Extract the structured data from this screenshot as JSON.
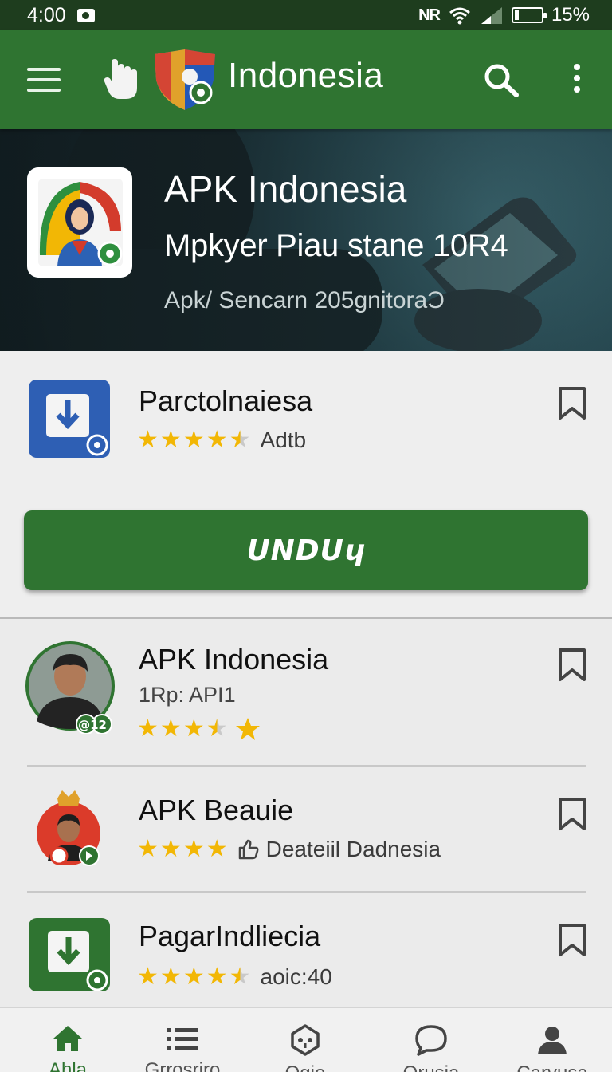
{
  "status_bar": {
    "time": "4:00",
    "nfc": "NR",
    "battery": "15%",
    "battery_level": 0.15
  },
  "app_bar": {
    "title": "Indonesia",
    "icons": [
      "menu-icon",
      "hand-icon",
      "shield-logo-icon",
      "search-icon",
      "more-vert-icon"
    ]
  },
  "hero": {
    "title": "APK Indonesia",
    "subtitle": "Mpkyer Piau stane 10R4",
    "meta": "Apk/ Sencarn 205gnitoraƆ"
  },
  "featured": {
    "name": "Parctolnaiesa",
    "rating_label": "Adtb",
    "stars": 4.5,
    "download_label": "UNDUɥ"
  },
  "list": [
    {
      "name": "APK Indonesia",
      "subtitle": "1Rp: API1",
      "stars": 3.5,
      "badge": "@12"
    },
    {
      "name": "APK Beauie",
      "stars": 4,
      "detail": "Deateiil Dadnesia"
    },
    {
      "name": "PagarIndliecia",
      "stars": 4.5,
      "detail": "aoic:40"
    }
  ],
  "bottom_nav": [
    {
      "label": "Ahla",
      "icon": "home-icon",
      "active": true
    },
    {
      "label": "Grrosriro",
      "icon": "list-icon",
      "active": false
    },
    {
      "label": "Ogio",
      "icon": "game-icon",
      "active": false
    },
    {
      "label": "Orusia",
      "icon": "chat-icon",
      "active": false
    },
    {
      "label": "Carvusa",
      "icon": "profile-icon",
      "active": false
    }
  ],
  "colors": {
    "primary": "#2f7431",
    "status_bar": "#1e3d1e",
    "star": "#f2b705",
    "background": "#ebebeb"
  }
}
